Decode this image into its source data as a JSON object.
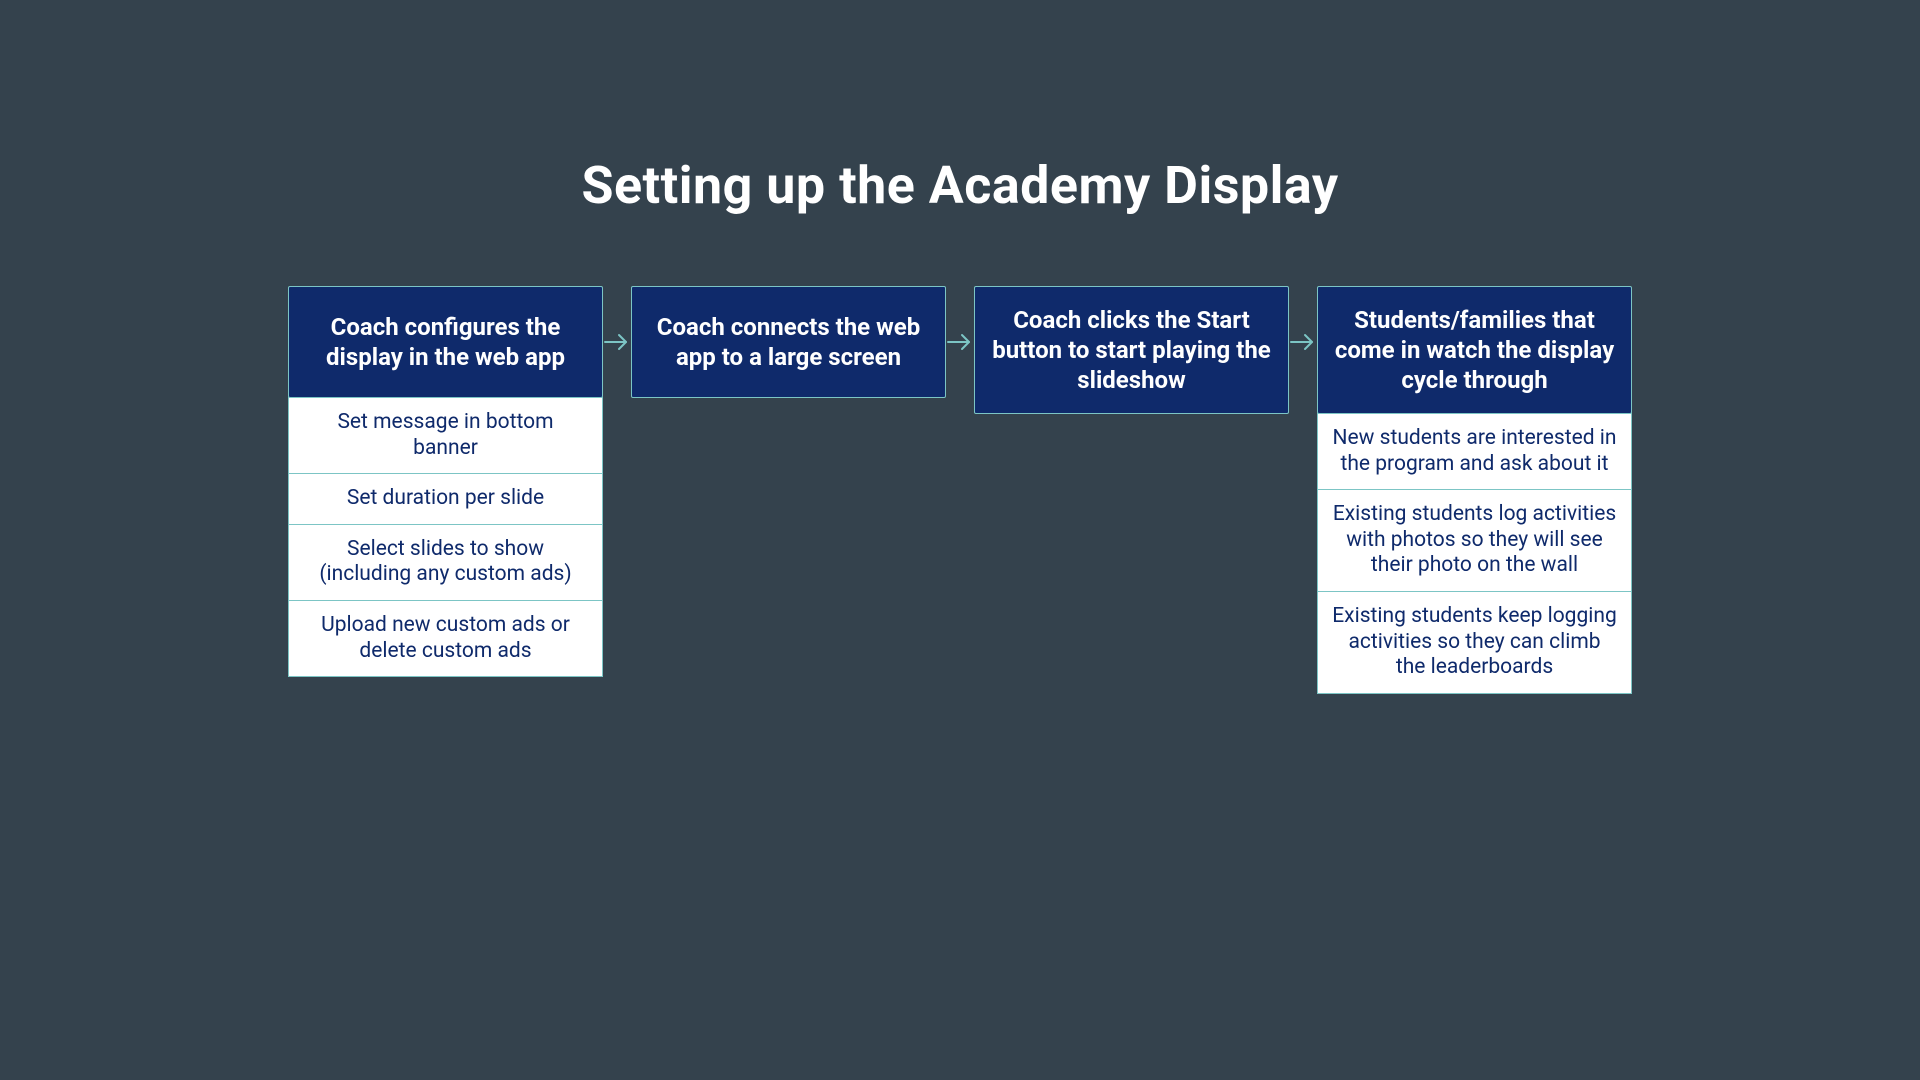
{
  "title": "Setting up the Academy Display",
  "steps": [
    {
      "header": "Coach configures the display in the web app",
      "details": [
        "Set message in bottom banner",
        "Set duration per slide",
        "Select slides to show (including any custom ads)",
        "Upload new custom ads or delete custom ads"
      ]
    },
    {
      "header": "Coach connects the web app to a large screen",
      "details": []
    },
    {
      "header": "Coach clicks the Start button to start playing the slideshow",
      "details": []
    },
    {
      "header": "Students/families that come in watch the display cycle through",
      "details": [
        "New students are interested in the program and ask about it",
        "Existing students log activities with photos so they will see their photo on the wall",
        "Existing students keep logging activities so they can climb the leaderboards"
      ]
    }
  ]
}
